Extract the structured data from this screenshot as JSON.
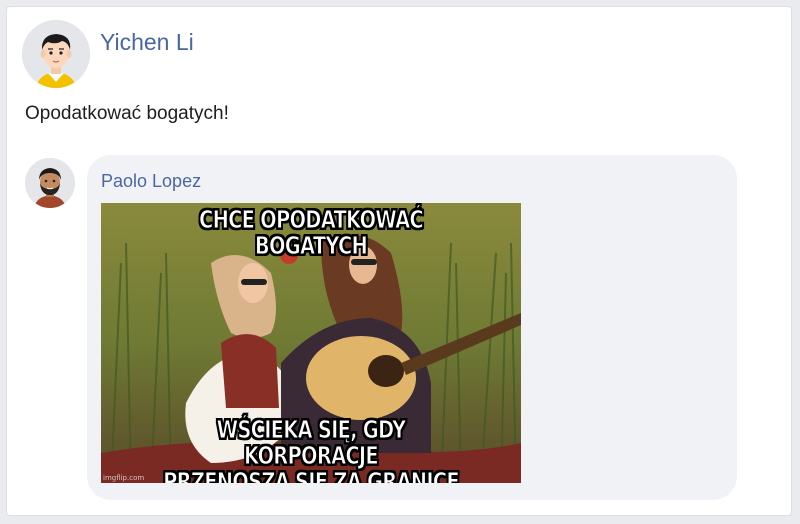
{
  "post": {
    "author": "Yichen Li",
    "text": "Opodatkować bogatych!"
  },
  "comment": {
    "author": "Paolo Lopez",
    "meme": {
      "top_caption": "CHCE OPODATKOWAĆ BOGATYCH",
      "bottom_caption_line1": "WŚCIEKA SIĘ, GDY KORPORACJE",
      "bottom_caption_line2": "PRZENOSZĄ SIĘ ZA GRANICĘ",
      "watermark": "imgflip.com"
    }
  },
  "icons": {
    "post_avatar": "avatar-man-black-hair-icon",
    "comment_avatar": "avatar-man-beard-icon"
  },
  "colors": {
    "name_link": "#4b67a1",
    "bubble": "#f0f2f5",
    "background": "#e9ebee"
  }
}
